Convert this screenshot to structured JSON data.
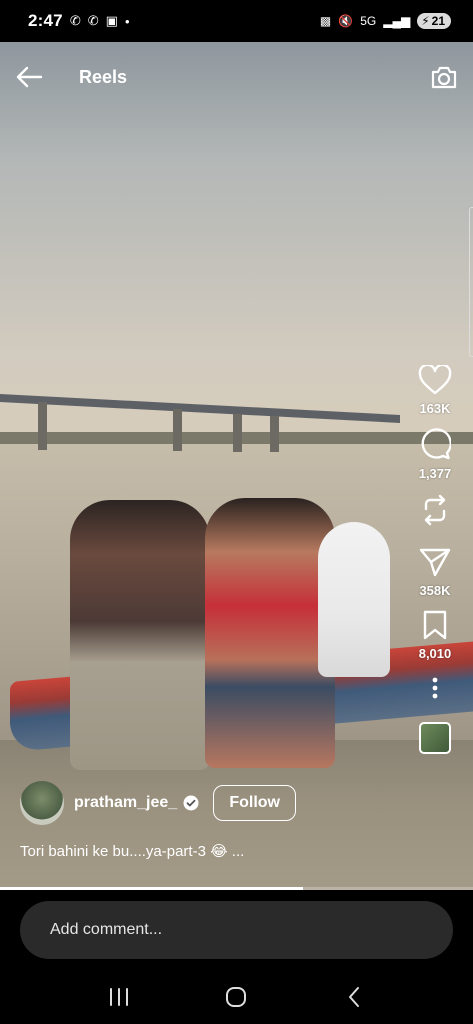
{
  "status_bar": {
    "time": "2:47",
    "battery": "21",
    "network": "5G"
  },
  "header": {
    "title": "Reels",
    "back_icon": "arrow-left-icon",
    "camera_icon": "camera-icon"
  },
  "actions": {
    "likes": "163K",
    "comments": "1,377",
    "reposts": "",
    "shares": "358K",
    "saves": "8,010"
  },
  "author": {
    "username": "pratham_jee_",
    "follow_label": "Follow"
  },
  "caption": "Tori bahini ke bu....ya-part-3 😂 ...",
  "progress": 0.64,
  "comment": {
    "placeholder": "Add comment..."
  },
  "colors": {
    "background": "#000000",
    "comment_bg": "#2a2a2a",
    "text": "#ffffff"
  }
}
